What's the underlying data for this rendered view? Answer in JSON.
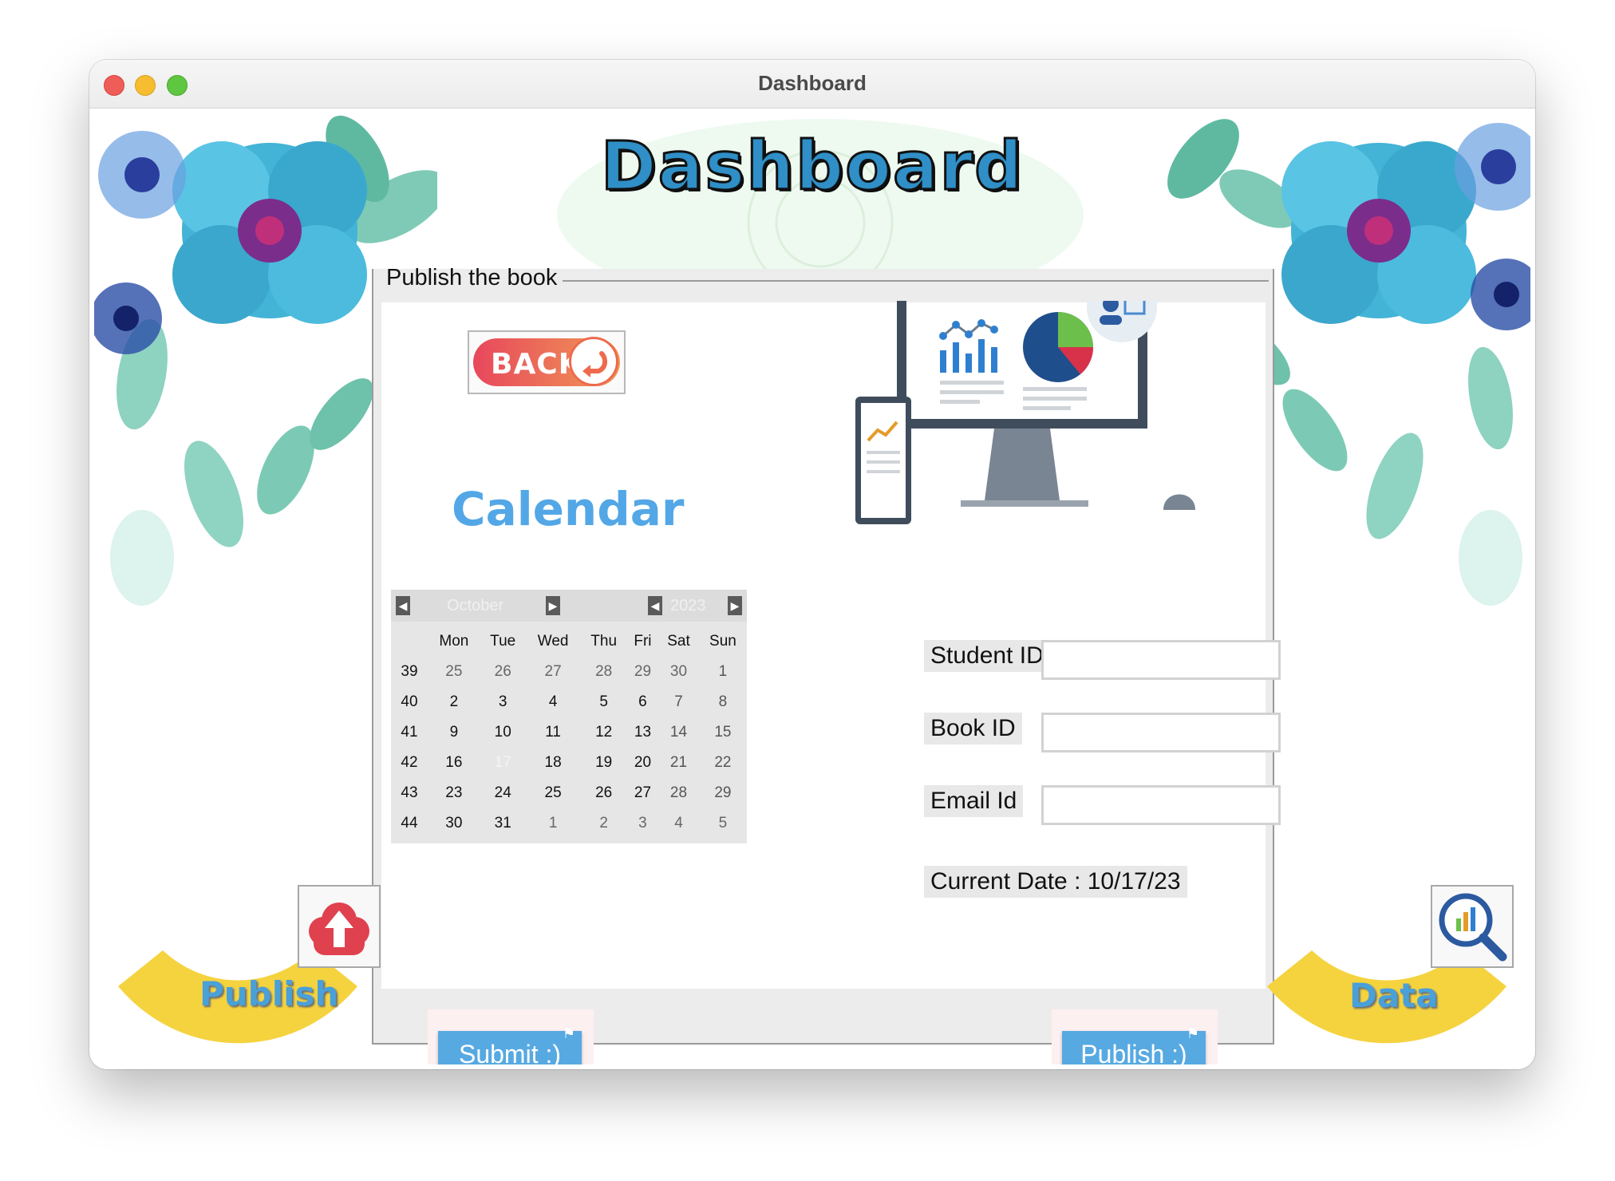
{
  "window": {
    "title": "Dashboard"
  },
  "banner": {
    "title": "Dashboard"
  },
  "group": {
    "label": "Publish the book"
  },
  "back_button": {
    "label": "BACK"
  },
  "calendar": {
    "heading": "Calendar",
    "month": "October",
    "year": "2023",
    "weekdays": [
      "Mon",
      "Tue",
      "Wed",
      "Thu",
      "Fri",
      "Sat",
      "Sun"
    ],
    "weeks": [
      {
        "number": "39",
        "days": [
          "25",
          "26",
          "27",
          "28",
          "29",
          "30",
          "1"
        ]
      },
      {
        "number": "40",
        "days": [
          "2",
          "3",
          "4",
          "5",
          "6",
          "7",
          "8"
        ]
      },
      {
        "number": "41",
        "days": [
          "9",
          "10",
          "11",
          "12",
          "13",
          "14",
          "15"
        ]
      },
      {
        "number": "42",
        "days": [
          "16",
          "17",
          "18",
          "19",
          "20",
          "21",
          "22"
        ]
      },
      {
        "number": "43",
        "days": [
          "23",
          "24",
          "25",
          "26",
          "27",
          "28",
          "29"
        ]
      },
      {
        "number": "44",
        "days": [
          "30",
          "31",
          "1",
          "2",
          "3",
          "4",
          "5"
        ]
      }
    ]
  },
  "form": {
    "student_id_label": "Student ID",
    "student_id_value": "",
    "book_id_label": "Book ID",
    "book_id_value": "",
    "email_label": "Email Id",
    "email_value": "",
    "current_date": "Current Date : 10/17/23"
  },
  "buttons": {
    "submit": "Submit :)",
    "publish": "Publish :)"
  },
  "side_nav": {
    "publish_label": "Publish",
    "publish_icon": "cloud-upload-icon",
    "data_label": "Data",
    "data_icon": "magnifier-chart-icon"
  },
  "colors": {
    "accent_blue": "#57a9e2",
    "ribbon_yellow": "#f5d33f",
    "back_red": "#e8475c"
  }
}
